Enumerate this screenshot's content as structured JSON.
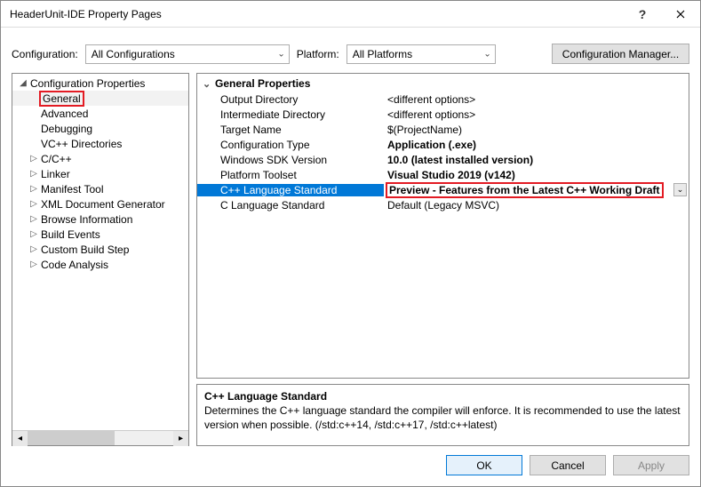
{
  "titlebar": {
    "title": "HeaderUnit-IDE Property Pages"
  },
  "config_row": {
    "config_label": "Configuration:",
    "config_value": "All Configurations",
    "platform_label": "Platform:",
    "platform_value": "All Platforms",
    "manager_btn": "Configuration Manager..."
  },
  "tree": {
    "root": "Configuration Properties",
    "items": [
      {
        "label": "General",
        "selected": true,
        "highlighted": true
      },
      {
        "label": "Advanced"
      },
      {
        "label": "Debugging"
      },
      {
        "label": "VC++ Directories"
      },
      {
        "label": "C/C++",
        "expandable": true
      },
      {
        "label": "Linker",
        "expandable": true
      },
      {
        "label": "Manifest Tool",
        "expandable": true
      },
      {
        "label": "XML Document Generator",
        "expandable": true
      },
      {
        "label": "Browse Information",
        "expandable": true
      },
      {
        "label": "Build Events",
        "expandable": true
      },
      {
        "label": "Custom Build Step",
        "expandable": true
      },
      {
        "label": "Code Analysis",
        "expandable": true
      }
    ]
  },
  "props": {
    "header": "General Properties",
    "rows": [
      {
        "k": "Output Directory",
        "v": "<different options>"
      },
      {
        "k": "Intermediate Directory",
        "v": "<different options>"
      },
      {
        "k": "Target Name",
        "v": "$(ProjectName)"
      },
      {
        "k": "Configuration Type",
        "v": "Application (.exe)",
        "bold": true
      },
      {
        "k": "Windows SDK Version",
        "v": "10.0 (latest installed version)",
        "bold": true
      },
      {
        "k": "Platform Toolset",
        "v": "Visual Studio 2019 (v142)",
        "bold": true
      },
      {
        "k": "C++ Language Standard",
        "v": "Preview - Features from the Latest C++ Working Draft",
        "selected": true,
        "highlighted": true,
        "dropdown": true
      },
      {
        "k": "C Language Standard",
        "v": "Default (Legacy MSVC)"
      }
    ]
  },
  "desc": {
    "title": "C++ Language Standard",
    "body": "Determines the C++ language standard the compiler will enforce. It is recommended to use the latest version when possible.  (/std:c++14, /std:c++17, /std:c++latest)"
  },
  "footer": {
    "ok": "OK",
    "cancel": "Cancel",
    "apply": "Apply"
  }
}
